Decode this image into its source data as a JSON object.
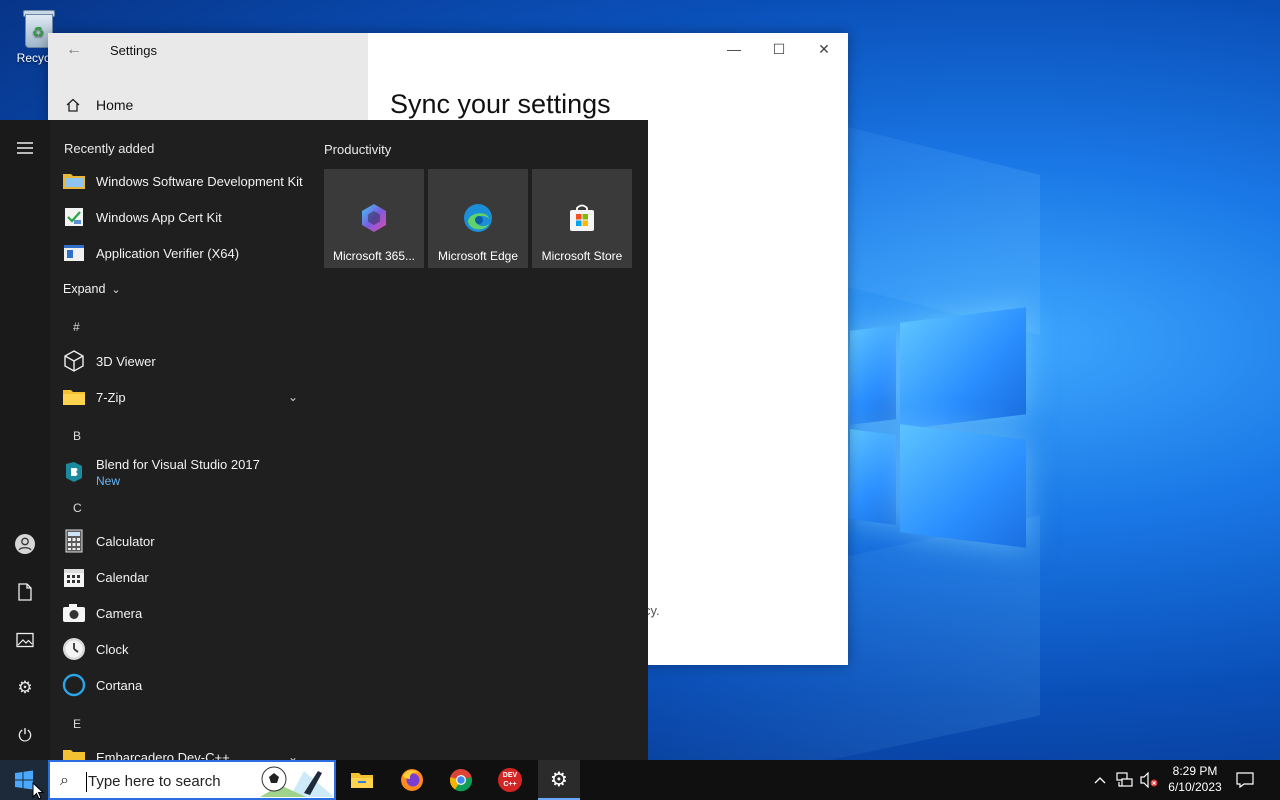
{
  "desktop": {
    "recycle_bin_label": "Recycle"
  },
  "settings_window": {
    "title": "Settings",
    "back": "←",
    "nav_home": "Home",
    "heading": "Sync your settings",
    "footer_fragment": "cy.",
    "controls": {
      "minimize": "—",
      "maximize": "☐",
      "close": "✕"
    }
  },
  "start_menu": {
    "recently_added_header": "Recently added",
    "recently_added": [
      {
        "label": "Windows Software Development Kit",
        "icon": "folder-icon"
      },
      {
        "label": "Windows App Cert Kit",
        "icon": "cert-kit-icon"
      },
      {
        "label": "Application Verifier (X64)",
        "icon": "app-verifier-icon"
      }
    ],
    "expand_label": "Expand",
    "groups": [
      {
        "letter": "#",
        "items": [
          {
            "label": "3D Viewer",
            "icon": "cube-icon"
          },
          {
            "label": "7-Zip",
            "icon": "folder-icon",
            "expandable": true
          }
        ]
      },
      {
        "letter": "B",
        "items": [
          {
            "label": "Blend for Visual Studio 2017",
            "sub": "New",
            "icon": "blend-icon"
          }
        ]
      },
      {
        "letter": "C",
        "items": [
          {
            "label": "Calculator",
            "icon": "calculator-icon"
          },
          {
            "label": "Calendar",
            "icon": "calendar-icon"
          },
          {
            "label": "Camera",
            "icon": "camera-icon"
          },
          {
            "label": "Clock",
            "icon": "clock-icon"
          },
          {
            "label": "Cortana",
            "icon": "cortana-icon"
          }
        ]
      },
      {
        "letter": "E",
        "items": [
          {
            "label": "Embarcadero Dev-C++",
            "icon": "folder-icon",
            "expandable": true
          }
        ]
      }
    ],
    "tiles_header": "Productivity",
    "tiles": [
      {
        "label": "Microsoft 365...",
        "icon": "m365-icon"
      },
      {
        "label": "Microsoft Edge",
        "icon": "edge-icon"
      },
      {
        "label": "Microsoft Store",
        "icon": "store-icon"
      }
    ]
  },
  "taskbar": {
    "search_placeholder": "Type here to search",
    "time": "8:29 PM",
    "date": "6/10/2023",
    "pinned": [
      "file-explorer-icon",
      "firefox-icon",
      "chrome-icon",
      "devcpp-icon",
      "settings-gear-icon"
    ],
    "devcpp_text": "DEV C++"
  }
}
